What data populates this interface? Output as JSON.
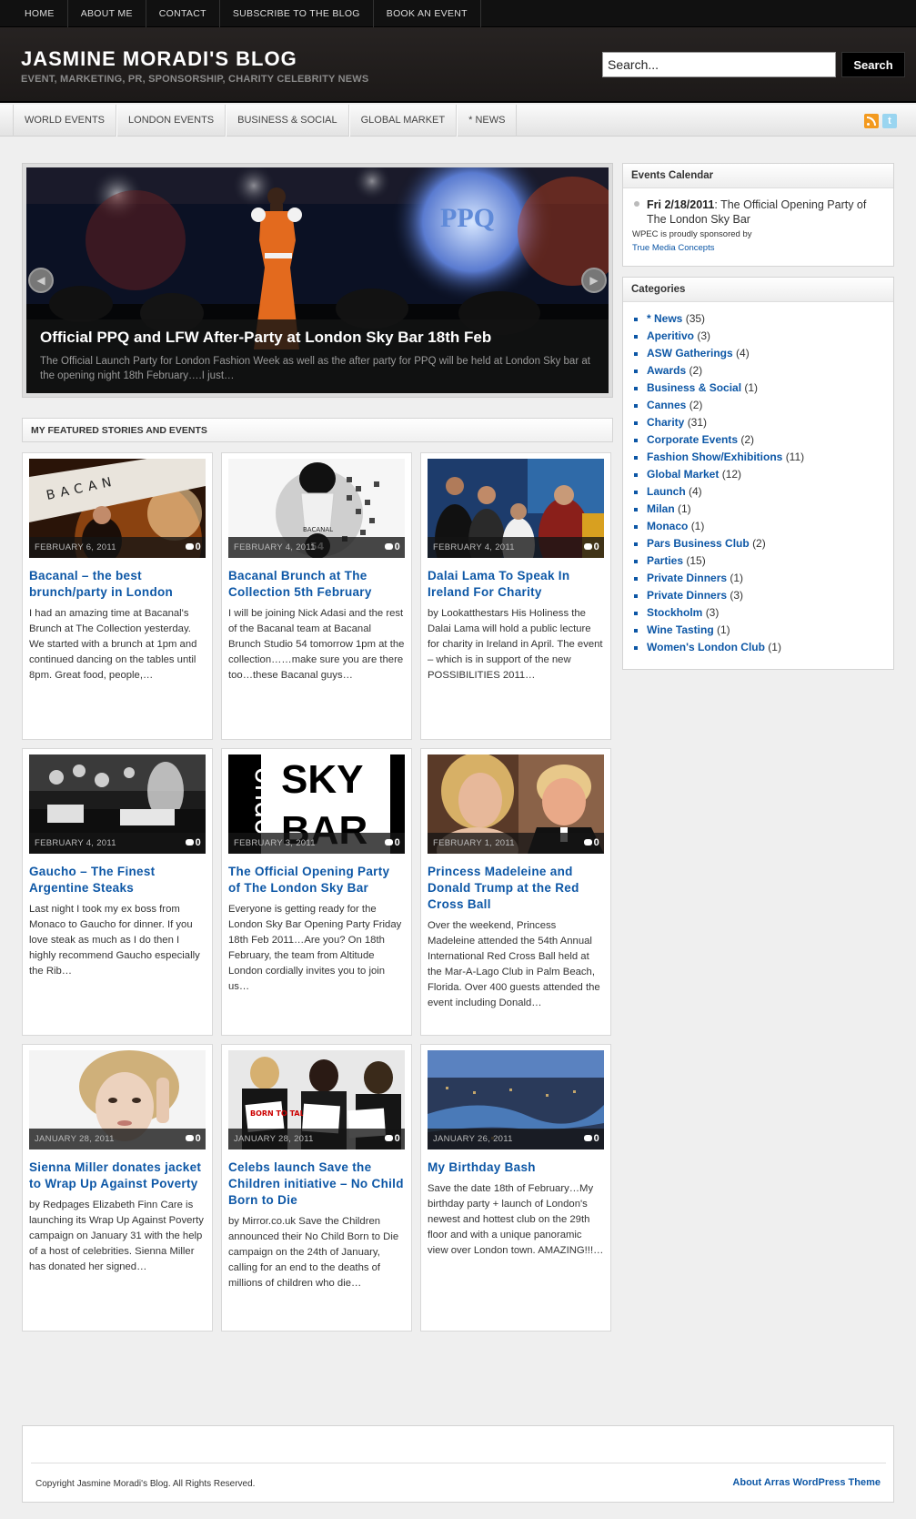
{
  "topnav": [
    "HOME",
    "ABOUT ME",
    "CONTACT",
    "SUBSCRIBE TO THE BLOG",
    "BOOK AN EVENT"
  ],
  "header": {
    "title": "JASMINE MORADI'S BLOG",
    "tagline": "EVENT, MARKETING, PR, SPONSORSHIP, CHARITY CELEBRITY NEWS",
    "search_placeholder": "Search...",
    "search_button": "Search"
  },
  "catnav": [
    "WORLD EVENTS",
    "LONDON EVENTS",
    "BUSINESS & SOCIAL",
    "GLOBAL MARKET",
    "* NEWS"
  ],
  "slider": {
    "title": "Official PPQ and LFW After-Party at London Sky Bar 18th Feb",
    "excerpt": "The Official Launch Party for London Fashion Week as well as the after party for PPQ will be held at London Sky bar at the opening night 18th February….I just…",
    "backdrop_text": "PPQ"
  },
  "featured_heading": "MY FEATURED STORIES AND EVENTS",
  "cards": [
    {
      "date": "FEBRUARY 6, 2011",
      "comments": "0",
      "title": "Bacanal – the best brunch/party in London",
      "excerpt": "I had an amazing time at Bacanal's Brunch at The Collection yesterday. We started with a brunch at 1pm and continued dancing on the tables until 8pm. Great food, people,…",
      "thumb_text": "BACAN"
    },
    {
      "date": "FEBRUARY 4, 2011",
      "comments": "0",
      "title": "Bacanal Brunch at The Collection 5th February",
      "excerpt": "I will be joining Nick Adasi and the rest of the Bacanal team at Bacanal Brunch Studio 54 tomorrow 1pm at the collection……make sure you are there too…these Bacanal guys…",
      "thumb_text": "BACANAL"
    },
    {
      "date": "FEBRUARY 4, 2011",
      "comments": "0",
      "title": "Dalai Lama To Speak In Ireland For Charity",
      "excerpt": "by Lookatthestars His Holiness the Dalai Lama will hold a public lecture for charity in Ireland in April. The event – which is in support of the new POSSIBILITIES 2011…",
      "thumb_text": ""
    },
    {
      "date": "FEBRUARY 4, 2011",
      "comments": "0",
      "title": "Gaucho – The Finest Argentine Steaks",
      "excerpt": "Last night I took my ex boss from Monaco to Gaucho for dinner. If you love steak as much as I do then I highly recommend Gaucho especially the Rib…",
      "thumb_text": ""
    },
    {
      "date": "FEBRUARY 3, 2011",
      "comments": "0",
      "title": "The Official Opening Party of The London Sky Bar",
      "excerpt": "Everyone is getting ready for the London Sky Bar Opening Party Friday 18th Feb 2011…Are you? On 18th February, the team from Altitude London cordially invites you to join us…",
      "thumb_text": "SKY BAR",
      "thumb_side": "ondo"
    },
    {
      "date": "FEBRUARY 1, 2011",
      "comments": "0",
      "title": "Princess Madeleine and Donald Trump at the Red Cross Ball",
      "excerpt": "Over the weekend, Princess Madeleine attended the 54th Annual International Red Cross Ball held at the Mar-A-Lago Club in Palm Beach, Florida.  Over 400 guests attended the event including Donald…",
      "thumb_text": ""
    },
    {
      "date": "JANUARY 28, 2011",
      "comments": "0",
      "title": "Sienna Miller donates jacket to Wrap Up Against Poverty",
      "excerpt": "by Redpages Elizabeth Finn Care is launching its Wrap Up Against Poverty campaign on January 31 with the help of a host of celebrities. Sienna Miller has donated her signed…",
      "thumb_text": ""
    },
    {
      "date": "JANUARY 28, 2011",
      "comments": "0",
      "title": "Celebs launch Save the Children initiative – No Child Born to Die",
      "excerpt": "by Mirror.co.uk Save the Children  announced their No Child Born to Die campaign on the 24th of January, calling for an end to the deaths of millions of children who die…",
      "thumb_text": "BORN TO TALK"
    },
    {
      "date": "JANUARY 26, 2011",
      "comments": "0",
      "title": "My Birthday Bash",
      "excerpt": "Save the date 18th of February…My birthday party + launch of London's newest and hottest club on the 29th floor and with a unique panoramic view over London town. AMAZING!!!…",
      "thumb_text": ""
    }
  ],
  "sidebar": {
    "calendar": {
      "title": "Events Calendar",
      "entry_date": "Fri 2/18/2011",
      "entry_text": ": The Official Opening Party of The London Sky Bar",
      "sponsor_text": "WPEC is proudly sponsored by",
      "sponsor_link": "True Media Concepts"
    },
    "categories": {
      "title": "Categories",
      "items": [
        {
          "name": "* News",
          "count": "(35)"
        },
        {
          "name": "Aperitivo",
          "count": "(3)"
        },
        {
          "name": "ASW Gatherings",
          "count": "(4)"
        },
        {
          "name": "Awards",
          "count": "(2)"
        },
        {
          "name": "Business & Social",
          "count": "(1)"
        },
        {
          "name": "Cannes",
          "count": "(2)"
        },
        {
          "name": "Charity",
          "count": "(31)"
        },
        {
          "name": "Corporate Events",
          "count": "(2)"
        },
        {
          "name": "Fashion Show/Exhibitions",
          "count": "(11)"
        },
        {
          "name": "Global Market",
          "count": "(12)"
        },
        {
          "name": "Launch",
          "count": "(4)"
        },
        {
          "name": "Milan",
          "count": "(1)"
        },
        {
          "name": "Monaco",
          "count": "(1)"
        },
        {
          "name": "Pars Business Club",
          "count": "(2)"
        },
        {
          "name": "Parties",
          "count": "(15)"
        },
        {
          "name": "Private Dinners",
          "count": "(1)"
        },
        {
          "name": "Private Dinners",
          "count": "(3)"
        },
        {
          "name": "Stockholm",
          "count": "(3)"
        },
        {
          "name": "Wine Tasting",
          "count": "(1)"
        },
        {
          "name": "Women's London Club",
          "count": "(1)"
        }
      ]
    }
  },
  "footer": {
    "copyright": "Copyright Jasmine Moradi's Blog. All Rights Reserved.",
    "theme_link": "About Arras WordPress Theme"
  },
  "colors": {
    "link": "#0d57a6",
    "topbar": "#111111",
    "header": "#221f1e"
  }
}
